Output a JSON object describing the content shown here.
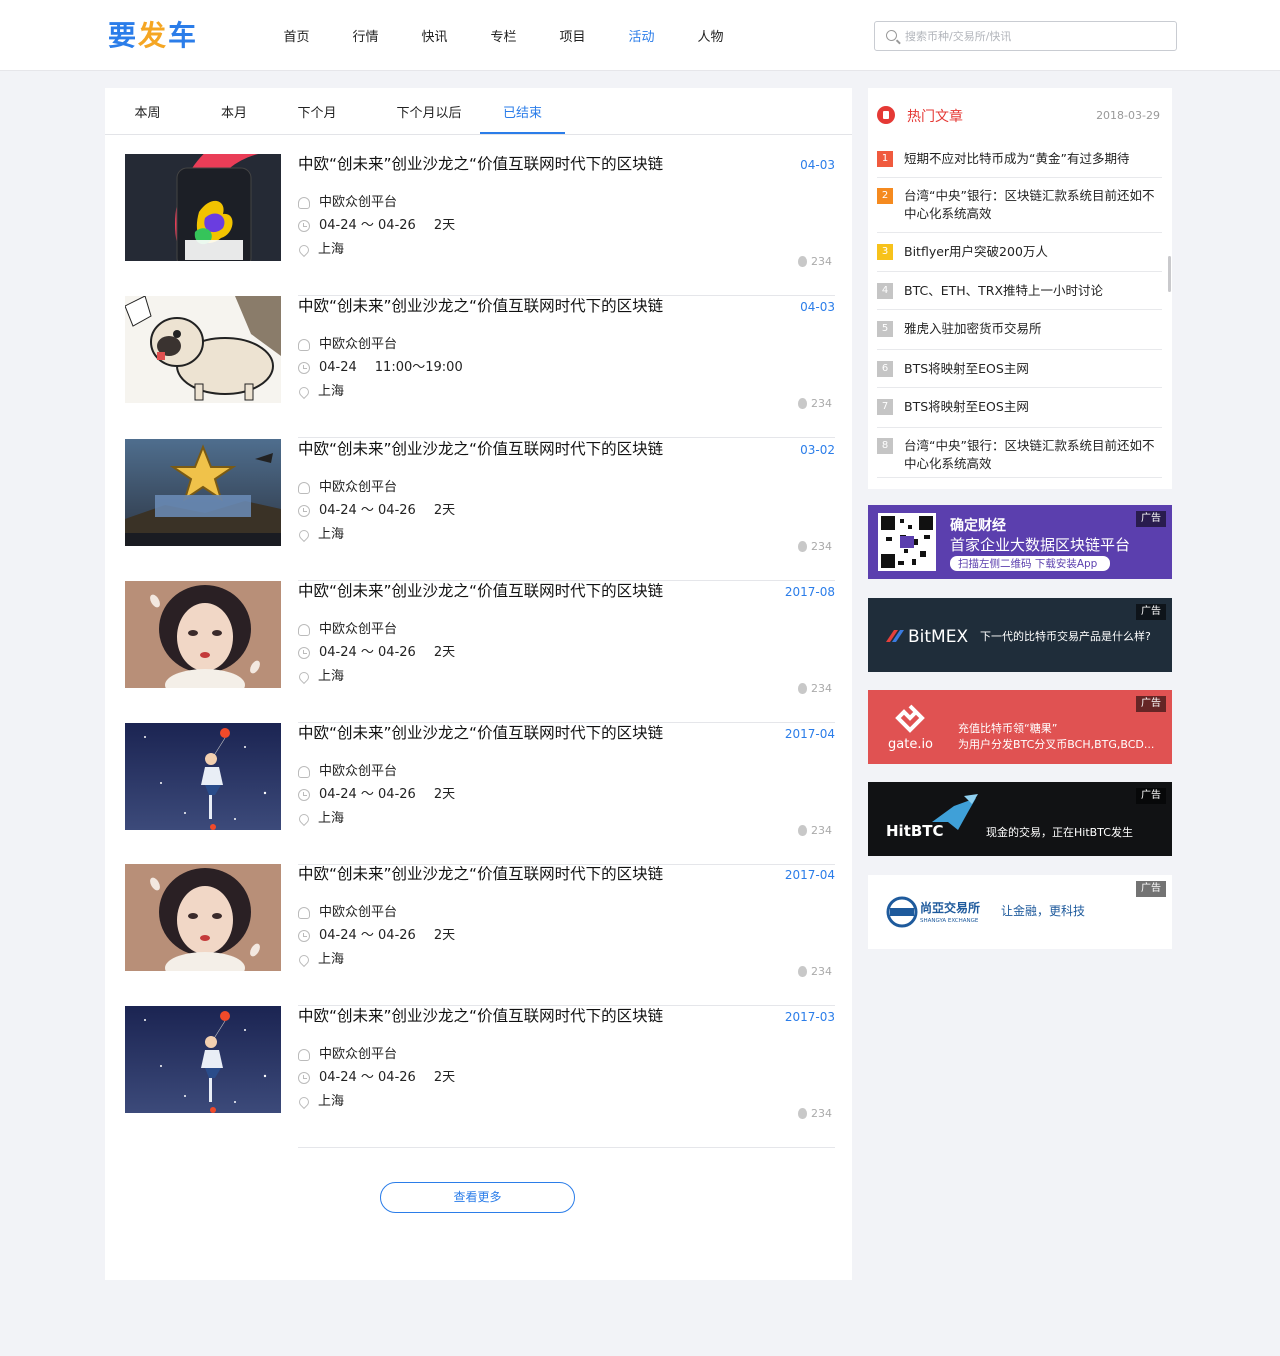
{
  "header": {
    "logo": [
      "要",
      "发",
      "车"
    ],
    "nav": [
      {
        "label": "首页",
        "active": false
      },
      {
        "label": "行情",
        "active": false
      },
      {
        "label": "快讯",
        "active": false
      },
      {
        "label": "专栏",
        "active": false
      },
      {
        "label": "项目",
        "active": false
      },
      {
        "label": "活动",
        "active": true
      },
      {
        "label": "人物",
        "active": false
      }
    ],
    "search_placeholder": "搜索币种/交易所/快讯"
  },
  "tabs": [
    {
      "label": "本周",
      "active": false
    },
    {
      "label": "本月",
      "active": false
    },
    {
      "label": "下个月",
      "active": false
    },
    {
      "label": "下个月以后",
      "active": false
    },
    {
      "label": "已结束",
      "active": true
    }
  ],
  "events": [
    {
      "title": "中欧“创未来”创业沙龙之“价值互联网时代下的区块链",
      "date": "04-03",
      "organizer": "中欧众创平台",
      "time_range": "04-24 ～ 04-26",
      "duration": "2天",
      "location": "上海",
      "hot": "234",
      "thumb": "phone-poster"
    },
    {
      "title": "中欧“创未来”创业沙龙之“价值互联网时代下的区块链",
      "date": "04-03",
      "organizer": "中欧众创平台",
      "time_range": "04-24",
      "duration": "11:00～19:00",
      "location": "上海",
      "hot": "234",
      "thumb": "pug-illustration"
    },
    {
      "title": "中欧“创未来”创业沙龙之“价值互联网时代下的区块链",
      "date": "03-02",
      "organizer": "中欧众创平台",
      "time_range": "04-24 ～ 04-26",
      "duration": "2天",
      "location": "上海",
      "hot": "234",
      "thumb": "game-ui-design"
    },
    {
      "title": "中欧“创未来”创业沙龙之“价值互联网时代下的区块链",
      "date": "2017-08",
      "organizer": "中欧众创平台",
      "time_range": "04-24 ～ 04-26",
      "duration": "2天",
      "location": "上海",
      "hot": "234",
      "thumb": "girl-portrait"
    },
    {
      "title": "中欧“创未来”创业沙龙之“价值互联网时代下的区块链",
      "date": "2017-04",
      "organizer": "中欧众创平台",
      "time_range": "04-24 ～ 04-26",
      "duration": "2天",
      "location": "上海",
      "hot": "234",
      "thumb": "starry-balloon"
    },
    {
      "title": "中欧“创未来”创业沙龙之“价值互联网时代下的区块链",
      "date": "2017-04",
      "organizer": "中欧众创平台",
      "time_range": "04-24 ～ 04-26",
      "duration": "2天",
      "location": "上海",
      "hot": "234",
      "thumb": "girl-portrait"
    },
    {
      "title": "中欧“创未来”创业沙龙之“价值互联网时代下的区块链",
      "date": "2017-03",
      "organizer": "中欧众创平台",
      "time_range": "04-24 ～ 04-26",
      "duration": "2天",
      "location": "上海",
      "hot": "234",
      "thumb": "starry-balloon"
    }
  ],
  "more_label": "查看更多",
  "hot_articles": {
    "title": "热门文章",
    "date": "2018-03-29",
    "items": [
      {
        "rank": "1",
        "text": "短期不应对比特币成为“黄金”有过多期待",
        "color": "#f05a3e"
      },
      {
        "rank": "2",
        "text": "台湾“中央”银行：区块链汇款系统目前还如不中心化系统高效",
        "color": "#f58a1f"
      },
      {
        "rank": "3",
        "text": "Bitflyer用户突破200万人",
        "color": "#f7c21b"
      },
      {
        "rank": "4",
        "text": "BTC、ETH、TRX推特上一小时讨论",
        "color": "#c5c5c5"
      },
      {
        "rank": "5",
        "text": "雅虎入驻加密货币交易所",
        "color": "#c5c5c5"
      },
      {
        "rank": "6",
        "text": "BTS将映射至EOS主网",
        "color": "#c5c5c5"
      },
      {
        "rank": "7",
        "text": "BTS将映射至EOS主网",
        "color": "#c5c5c5"
      },
      {
        "rank": "8",
        "text": "台湾“中央”银行：区块链汇款系统目前还如不中心化系统高效",
        "color": "#c5c5c5"
      }
    ]
  },
  "ads": [
    {
      "tag": "广告",
      "brand": "确定财经",
      "line1": "首家企业大数据区块链平台",
      "line2": "扫描左侧二维码 下载安装App",
      "bg": "#5b3fae"
    },
    {
      "tag": "广告",
      "brand": "BitMEX",
      "line1": "下一代的比特币交易产品是什么样?",
      "bg": "#1f2d3a"
    },
    {
      "tag": "广告",
      "brand": "gate.io",
      "line1": "充值比特币领“糖果”",
      "line2": "为用户分发BTC分叉币BCH,BTG,BCD...",
      "bg": "#e05252"
    },
    {
      "tag": "广告",
      "brand": "HitBTC",
      "line1": "现金的交易，正在HitBTC发生",
      "bg": "#111214"
    },
    {
      "tag": "广告",
      "brand": "尚亞交易所",
      "sub": "SHANGYA EXCHANGE",
      "line1": "让金融，更科技",
      "bg": "#ffffff"
    }
  ]
}
